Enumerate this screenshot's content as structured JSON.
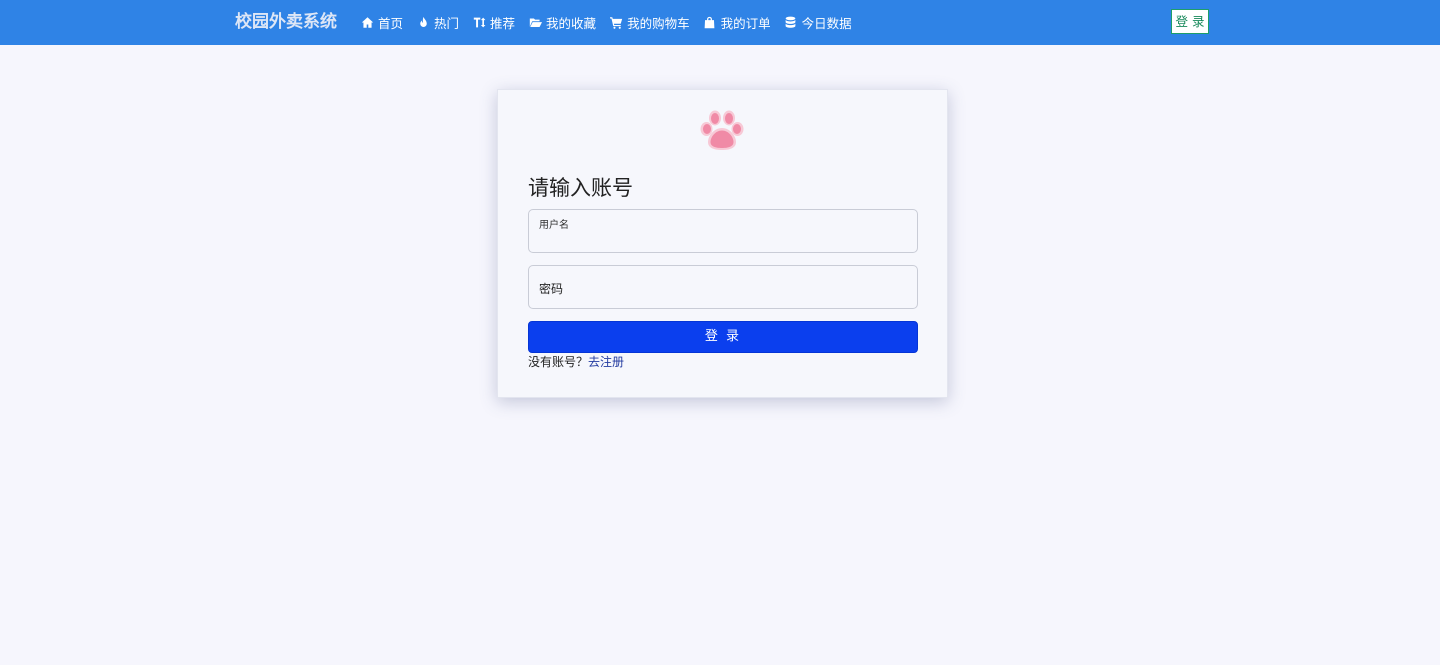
{
  "navbar": {
    "brand": "校园外卖系统",
    "items": [
      {
        "label": "首页",
        "icon": "home-icon"
      },
      {
        "label": "热门",
        "icon": "fire-icon"
      },
      {
        "label": "推荐",
        "icon": "text-height-icon"
      },
      {
        "label": "我的收藏",
        "icon": "folder-open-icon"
      },
      {
        "label": "我的购物车",
        "icon": "cart-icon"
      },
      {
        "label": "我的订单",
        "icon": "bag-icon"
      },
      {
        "label": "今日数据",
        "icon": "database-icon"
      }
    ],
    "login_label": "登 录"
  },
  "login_form": {
    "logo_icon": "paw-icon",
    "title": "请输入账号",
    "username_label": "用户名",
    "password_label": "密码",
    "submit_label": "登 录",
    "register_prompt": "没有账号？",
    "register_link": "去注册"
  },
  "colors": {
    "navbar_bg": "#2f83e6",
    "page_bg": "#f6f6fd",
    "submit_bg": "#0b3fee",
    "paw": "#f08aa6"
  }
}
